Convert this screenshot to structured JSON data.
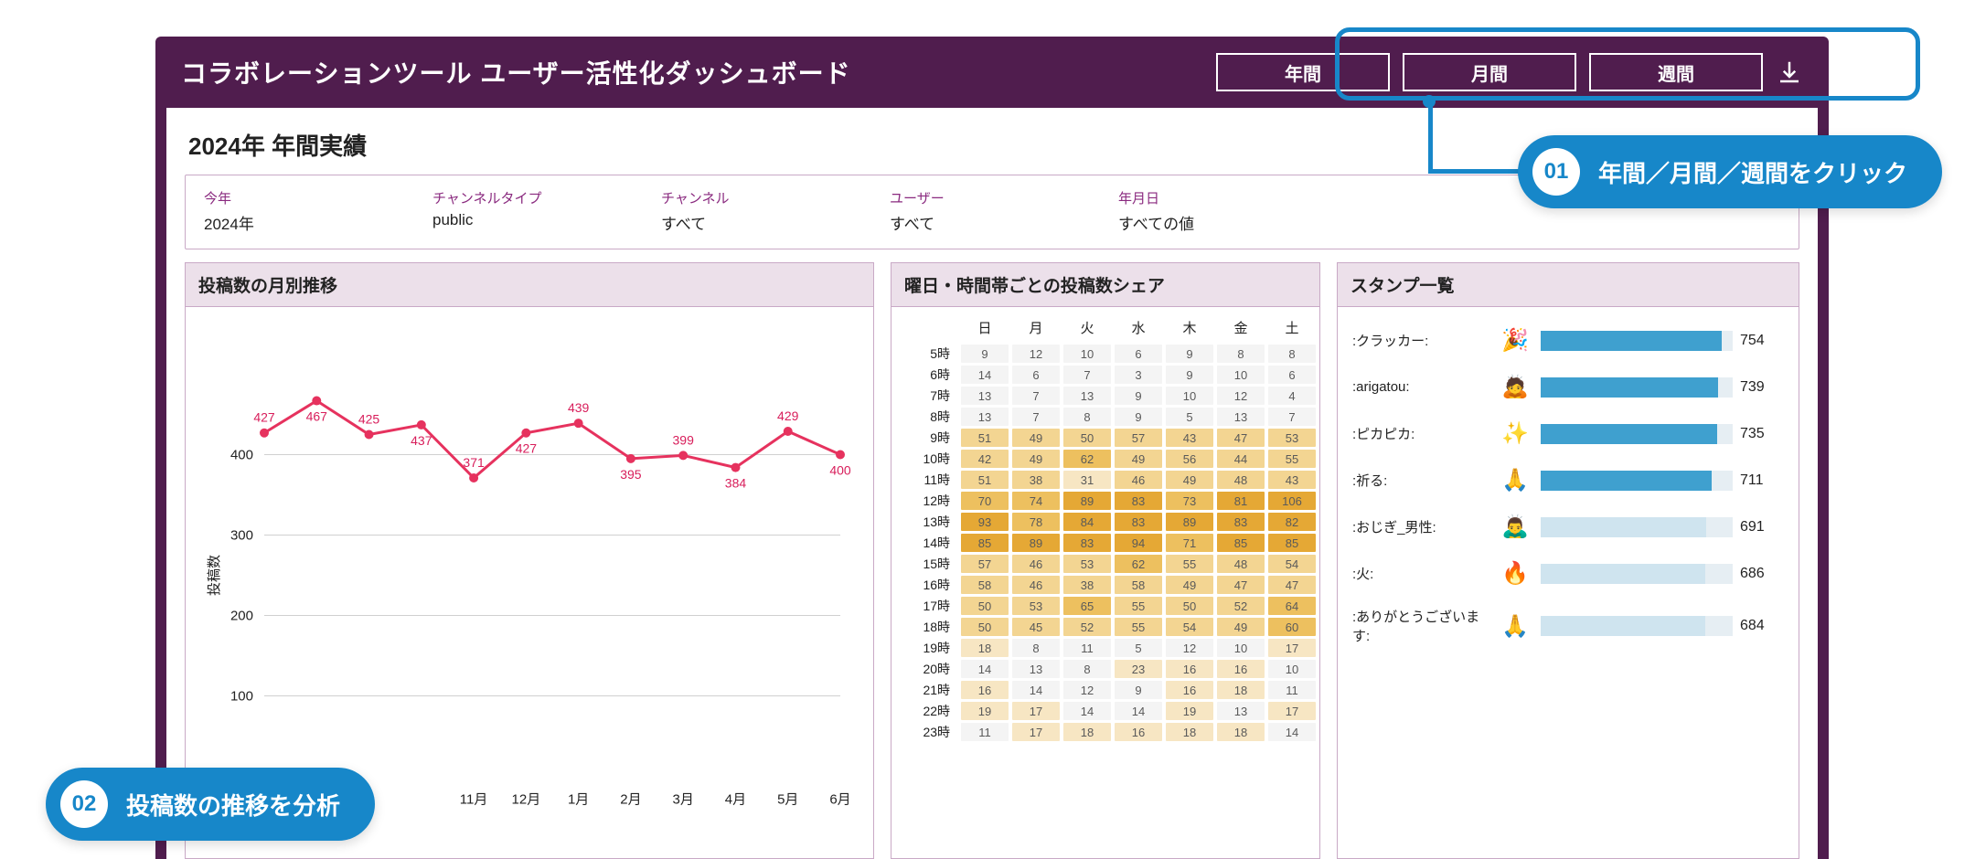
{
  "header": {
    "title": "コラボレーションツール ユーザー活性化ダッシュボード",
    "tabs": [
      "年間",
      "月間",
      "週間"
    ]
  },
  "summary_title": "2024年 年間実績",
  "filters": [
    {
      "label": "今年",
      "value": "2024年"
    },
    {
      "label": "チャンネルタイプ",
      "value": "public"
    },
    {
      "label": "チャンネル",
      "value": "すべて"
    },
    {
      "label": "ユーザー",
      "value": "すべて"
    },
    {
      "label": "年月日",
      "value": "すべての値"
    }
  ],
  "panels": {
    "line": {
      "title": "投稿数の月別推移"
    },
    "heat": {
      "title": "曜日・時間帯ごとの投稿数シェア"
    },
    "stamp": {
      "title": "スタンプ一覧"
    }
  },
  "callouts": {
    "c1": {
      "num": "01",
      "text": "年間／月間／週間をクリック"
    },
    "c2": {
      "num": "02",
      "text": "投稿数の推移を分析"
    }
  },
  "chart_data": [
    {
      "type": "line",
      "title": "投稿数の月別推移",
      "ylabel": "投稿数",
      "ylim": [
        0,
        500
      ],
      "yticks": [
        100,
        200,
        300,
        400
      ],
      "categories": [
        "",
        "",
        "",
        "11月",
        "12月",
        "1月",
        "2月",
        "3月",
        "4月",
        "5月",
        "6月"
      ],
      "values": [
        427,
        467,
        425,
        437,
        371,
        427,
        439,
        395,
        399,
        384,
        429,
        400
      ]
    },
    {
      "type": "heatmap",
      "title": "曜日・時間帯ごとの投稿数シェア",
      "columns": [
        "日",
        "月",
        "火",
        "水",
        "木",
        "金",
        "土"
      ],
      "rows": [
        "5時",
        "6時",
        "7時",
        "8時",
        "9時",
        "10時",
        "11時",
        "12時",
        "13時",
        "14時",
        "15時",
        "16時",
        "17時",
        "18時",
        "19時",
        "20時",
        "21時",
        "22時",
        "23時"
      ],
      "data": [
        [
          9,
          12,
          10,
          6,
          9,
          8,
          8
        ],
        [
          14,
          6,
          7,
          3,
          9,
          10,
          6
        ],
        [
          13,
          7,
          13,
          9,
          10,
          12,
          4
        ],
        [
          13,
          7,
          8,
          9,
          5,
          13,
          7
        ],
        [
          51,
          49,
          50,
          57,
          43,
          47,
          53
        ],
        [
          42,
          49,
          62,
          49,
          56,
          44,
          55
        ],
        [
          51,
          38,
          31,
          46,
          49,
          48,
          43
        ],
        [
          70,
          74,
          89,
          83,
          73,
          81,
          106
        ],
        [
          93,
          78,
          84,
          83,
          89,
          83,
          82
        ],
        [
          85,
          89,
          83,
          94,
          71,
          85,
          85
        ],
        [
          57,
          46,
          53,
          62,
          55,
          48,
          54
        ],
        [
          58,
          46,
          38,
          58,
          49,
          47,
          47
        ],
        [
          50,
          53,
          65,
          55,
          50,
          52,
          64
        ],
        [
          50,
          45,
          52,
          55,
          54,
          49,
          60
        ],
        [
          18,
          8,
          11,
          5,
          12,
          10,
          17
        ],
        [
          14,
          13,
          8,
          23,
          16,
          16,
          10
        ],
        [
          16,
          14,
          12,
          9,
          16,
          18,
          11
        ],
        [
          19,
          17,
          14,
          14,
          19,
          13,
          17
        ],
        [
          11,
          17,
          18,
          16,
          18,
          18,
          14
        ]
      ]
    },
    {
      "type": "bar",
      "title": "スタンプ一覧",
      "categories": [
        ":クラッカー:",
        ":arigatou:",
        ":ピカピカ:",
        ":祈る:",
        ":おじぎ_男性:",
        ":火:",
        ":ありがとうございます:"
      ],
      "emojis": [
        "🎉",
        "🙇",
        "✨",
        "🙏",
        "🙇‍♂️",
        "🔥",
        "🙏"
      ],
      "values": [
        754,
        739,
        735,
        711,
        691,
        686,
        684
      ],
      "xlim": [
        0,
        800
      ]
    }
  ]
}
